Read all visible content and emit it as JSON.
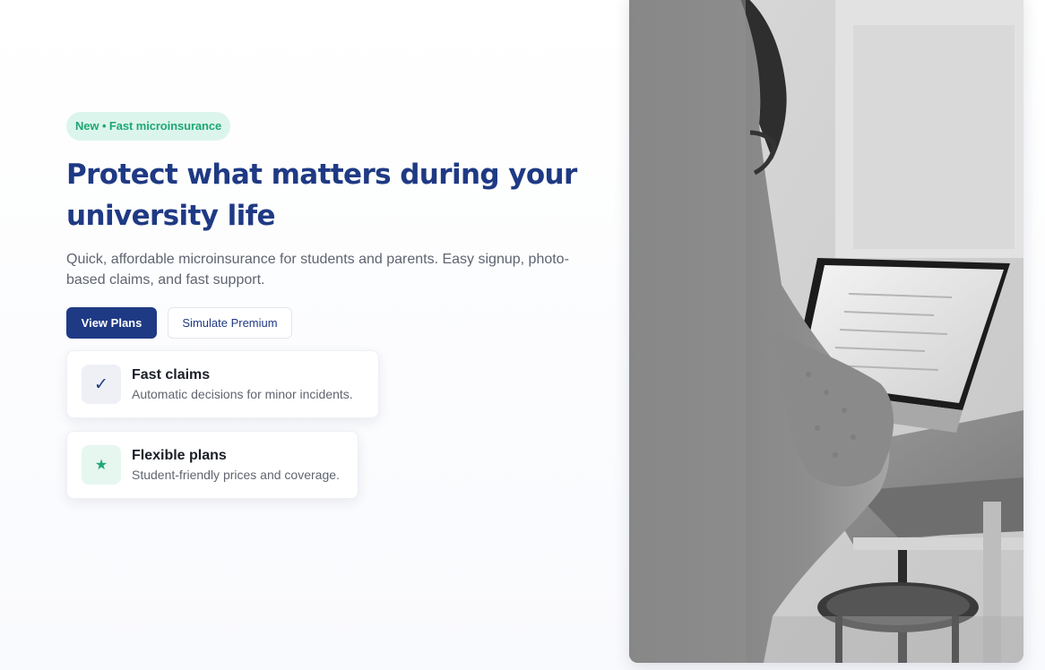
{
  "hero": {
    "badge": "New • Fast microinsurance",
    "title": "Protect what matters during your university life",
    "subtitle": "Quick, affordable microinsurance for students and parents. Easy signup, photo-based claims, and fast support.",
    "primary_button": "View Plans",
    "secondary_button": "Simulate Premium"
  },
  "features": [
    {
      "icon": "checkmark-icon",
      "glyph": "✓",
      "title": "Fast claims",
      "description": "Automatic decisions for minor incidents."
    },
    {
      "icon": "star-icon",
      "glyph": "★",
      "title": "Flexible plans",
      "description": "Student-friendly prices and coverage."
    }
  ],
  "image": {
    "subject": "black-and-white photo of a student using a laptop at a desk"
  },
  "colors": {
    "brand": "#1f3a84",
    "accent_green": "#1fa774",
    "badge_bg": "#dcf5ec",
    "text_muted": "#5f6470"
  }
}
